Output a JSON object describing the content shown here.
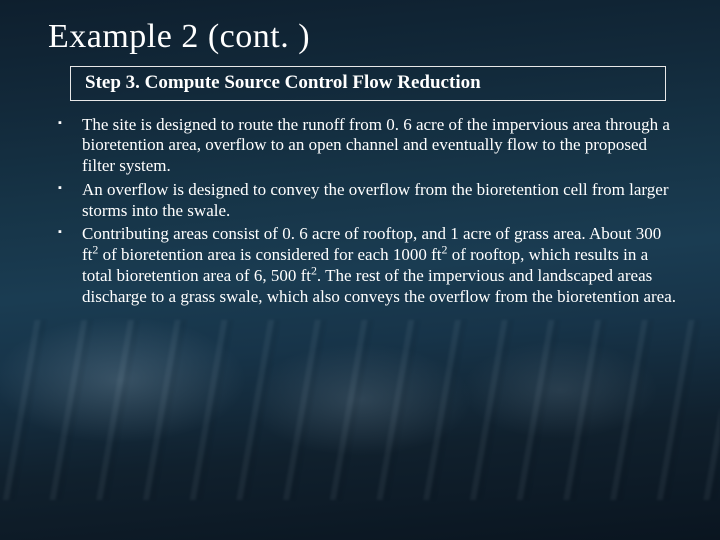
{
  "title": "Example 2 (cont. )",
  "step_heading": "Step 3. Compute Source Control Flow Reduction",
  "bullets": [
    "The site is designed to route the runoff from 0. 6 acre of the impervious area through a bioretention area, overflow to an open channel and eventually flow to the proposed filter system.",
    "An overflow is designed to convey the overflow from the bioretention cell from larger storms into the swale.",
    "Contributing areas consist of 0. 6 acre of rooftop, and 1 acre of grass area. About 300 ft² of bioretention area is considered for each 1000 ft² of rooftop, which results in a total bioretention area of 6, 500 ft². The rest of the impervious and landscaped areas discharge to a grass swale, which also conveys the overflow from the bioretention area."
  ]
}
